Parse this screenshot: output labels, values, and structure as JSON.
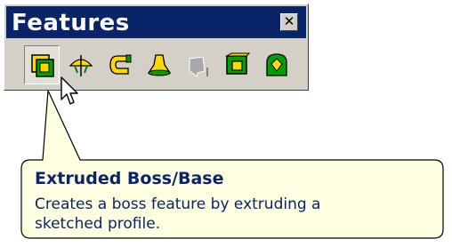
{
  "toolbar": {
    "title": "Features",
    "close_label": "✕",
    "buttons": [
      {
        "icon": "extruded-boss-base-icon"
      },
      {
        "icon": "revolved-boss-base-icon"
      },
      {
        "icon": "swept-boss-base-icon"
      },
      {
        "icon": "lofted-boss-base-icon"
      },
      {
        "icon": "disabled-feature-icon"
      },
      {
        "icon": "extruded-cut-icon"
      },
      {
        "icon": "fillet-icon"
      }
    ]
  },
  "tooltip": {
    "title": "Extruded Boss/Base",
    "description": "Creates a boss feature by extruding a sketched profile."
  },
  "colors": {
    "titlebar": "#0a246a",
    "tooltip_bg": "#ffffe1",
    "icon_yellow": "#ffd800",
    "icon_green": "#008000"
  }
}
